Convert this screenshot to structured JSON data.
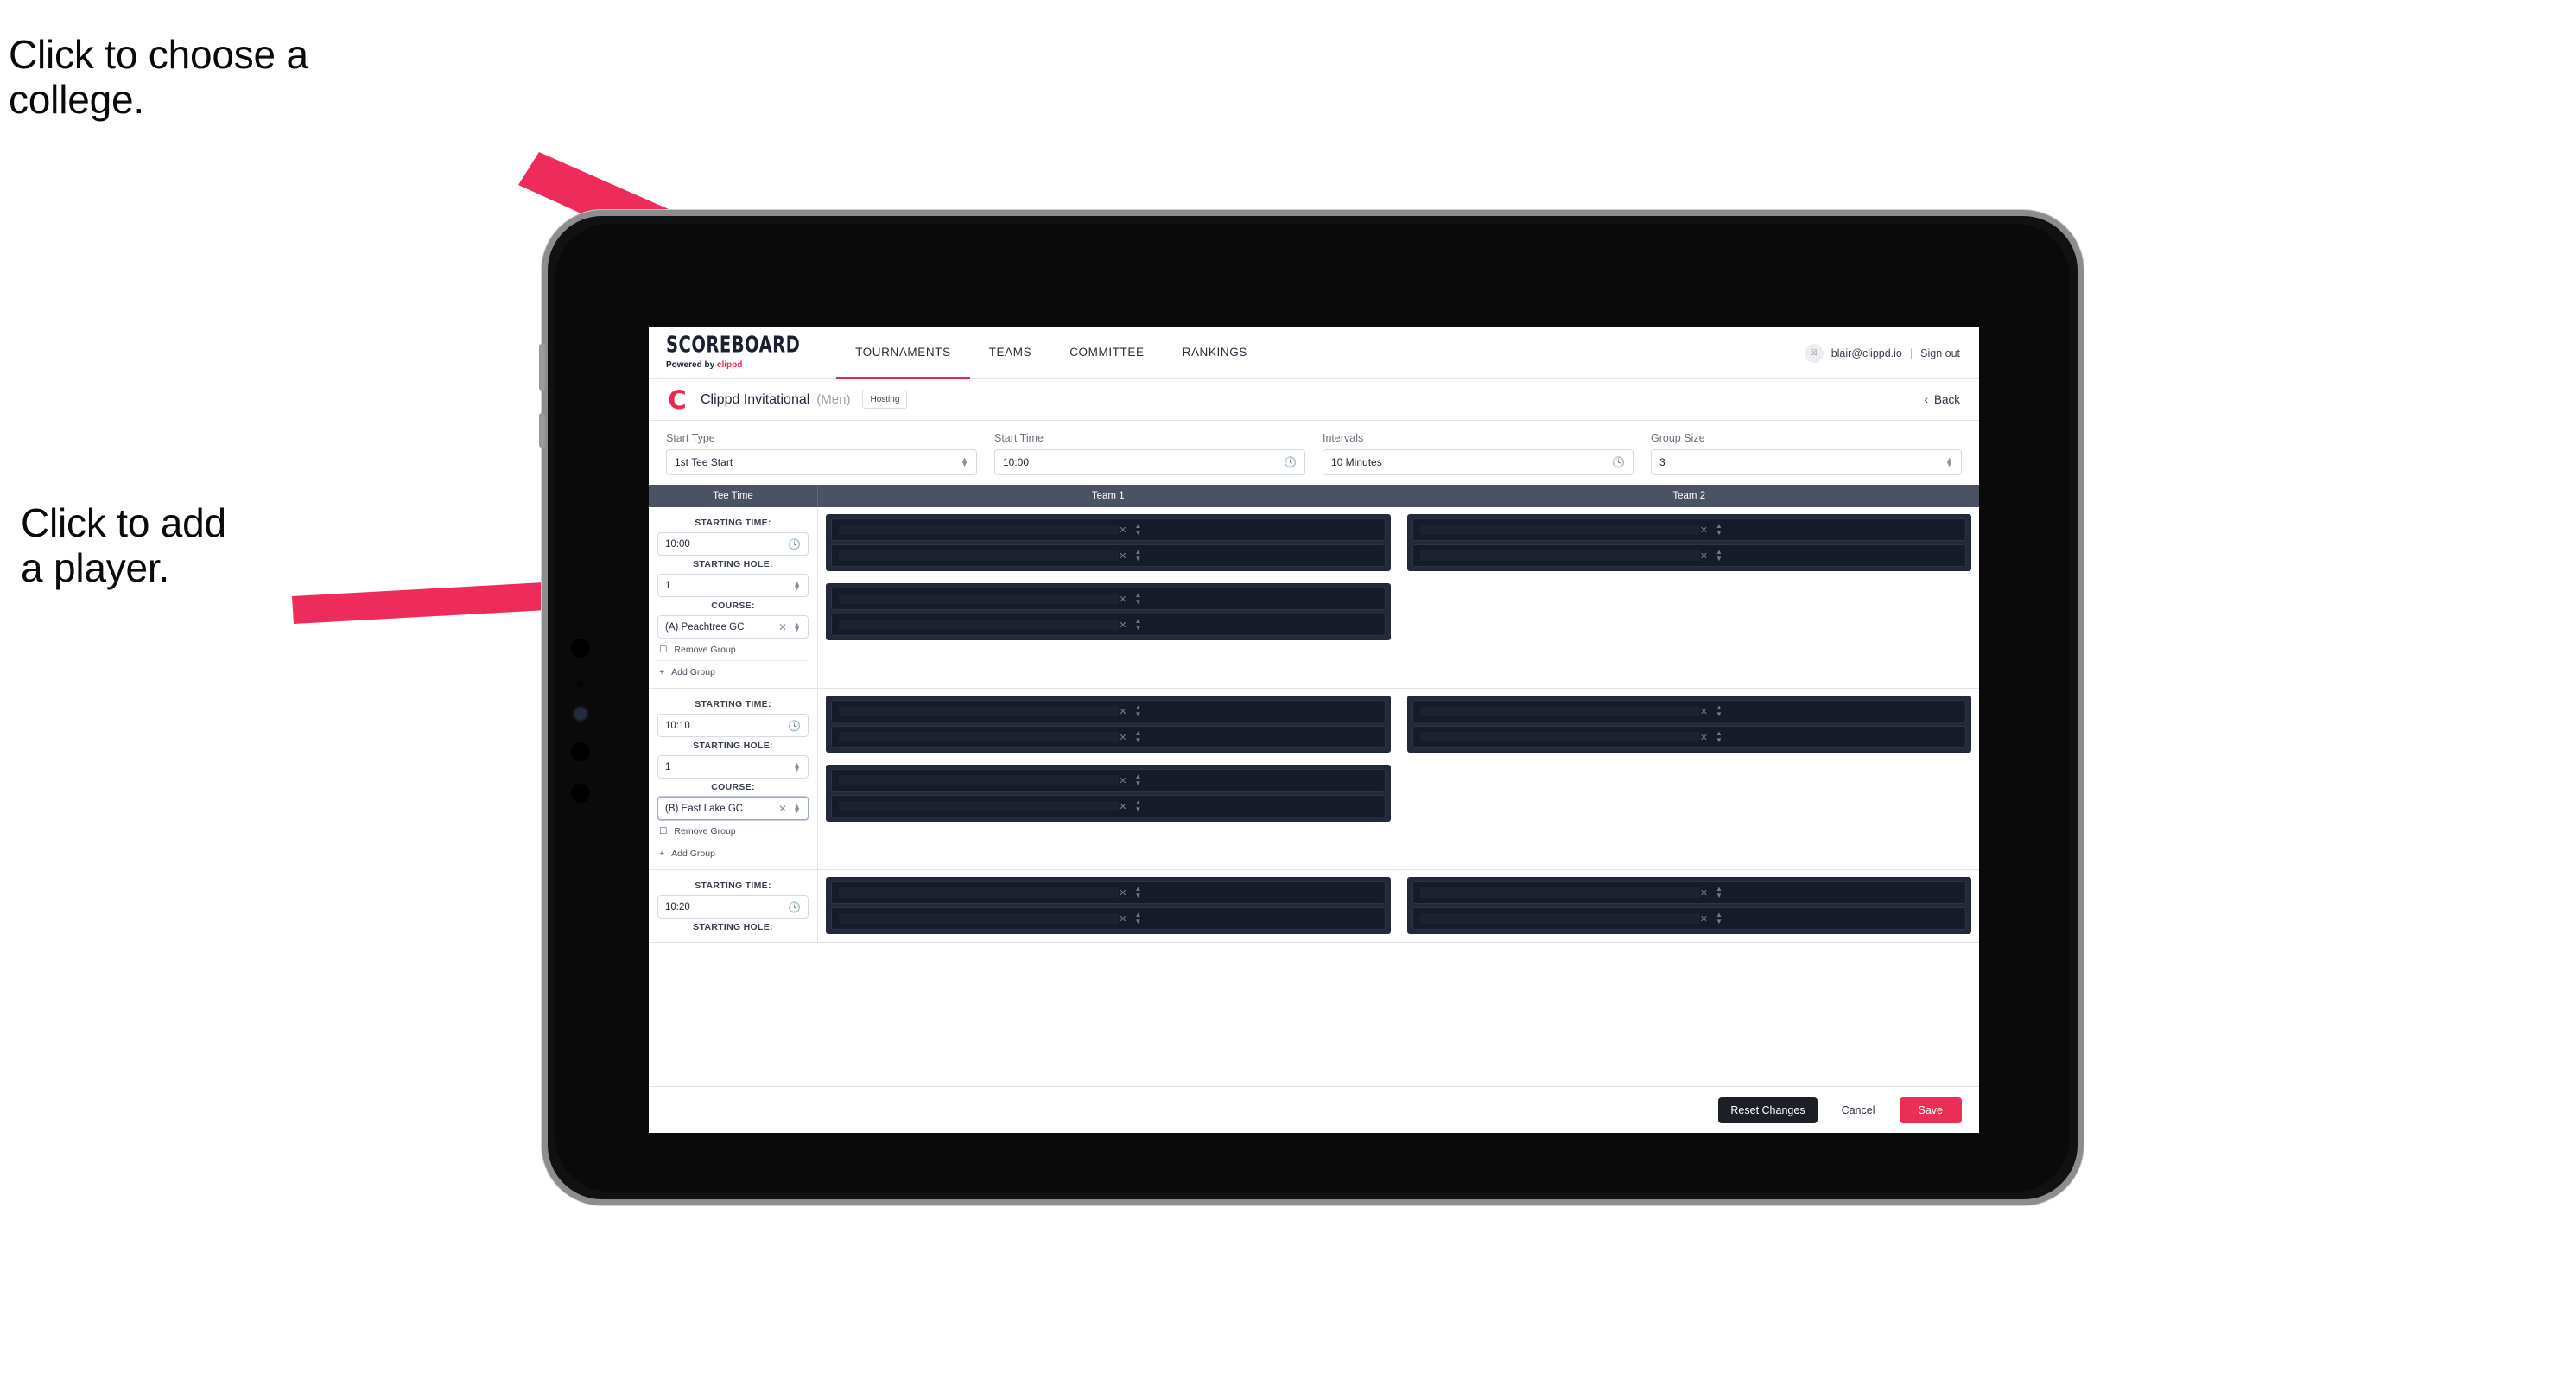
{
  "annotations": [
    {
      "id": "college",
      "text": "Click to choose a\ncollege."
    },
    {
      "id": "player",
      "text": "Click to add\na player."
    }
  ],
  "colors": {
    "accent": "#e8274f",
    "arrow": "#ee2c5c",
    "table_header_bg": "#4b5263",
    "player_row_bg": "#151b28",
    "group_card_bg": "#222a3a",
    "save_button": "#ea2f57",
    "reset_button": "#1d1f26"
  },
  "topnav": {
    "logo_main": "SCOREBOARD",
    "logo_sub_prefix": "Powered by ",
    "logo_sub_brand": "clippd",
    "items": [
      {
        "label": "TOURNAMENTS",
        "active": true
      },
      {
        "label": "TEAMS",
        "active": false
      },
      {
        "label": "COMMITTEE",
        "active": false
      },
      {
        "label": "RANKINGS",
        "active": false
      }
    ],
    "avatar_glyph": "☒",
    "user_email": "blair@clippd.io",
    "separator": "|",
    "signout_label": "Sign out"
  },
  "subheader": {
    "tournament_logo": "C",
    "title": "Clippd Invitational",
    "gender": "(Men)",
    "badge": "Hosting",
    "back_chevron": "‹",
    "back_label": "Back"
  },
  "filters": [
    {
      "label": "Start Type",
      "value": "1st Tee Start",
      "control": "stepper"
    },
    {
      "label": "Start Time",
      "value": "10:00",
      "control": "clock"
    },
    {
      "label": "Intervals",
      "value": "10 Minutes",
      "control": "clock"
    },
    {
      "label": "Group Size",
      "value": "3",
      "control": "stepper"
    }
  ],
  "table": {
    "columns": [
      "Tee Time",
      "Team 1",
      "Team 2"
    ],
    "labels": {
      "starting_time": "STARTING TIME:",
      "starting_hole": "STARTING HOLE:",
      "course": "COURSE:",
      "remove_group": "Remove Group",
      "add_group": "Add Group",
      "remove_icon": "✕",
      "clear_icon": "✕",
      "trash_icon": "☐",
      "plus_icon": "+",
      "clock_icon": "◴"
    },
    "rows": [
      {
        "starting_time": "10:00",
        "starting_hole": "1",
        "course": "(A) Peachtree GC",
        "course_focused": false,
        "team1_groups": [
          {
            "players": [
              "",
              ""
            ]
          },
          {
            "players": [
              "",
              ""
            ]
          }
        ],
        "team2_groups": [
          {
            "players": [
              "",
              ""
            ]
          }
        ]
      },
      {
        "starting_time": "10:10",
        "starting_hole": "1",
        "course": "(B) East Lake GC",
        "course_focused": true,
        "team1_groups": [
          {
            "players": [
              "",
              ""
            ]
          },
          {
            "players": [
              "",
              ""
            ]
          }
        ],
        "team2_groups": [
          {
            "players": [
              "",
              ""
            ]
          }
        ]
      },
      {
        "starting_time": "10:20",
        "starting_hole": "",
        "course": "",
        "course_focused": false,
        "team1_groups": [
          {
            "players": [
              "",
              ""
            ]
          }
        ],
        "team2_groups": [
          {
            "players": [
              "",
              ""
            ]
          }
        ]
      }
    ]
  },
  "footer": {
    "reset_label": "Reset Changes",
    "cancel_label": "Cancel",
    "save_label": "Save"
  }
}
